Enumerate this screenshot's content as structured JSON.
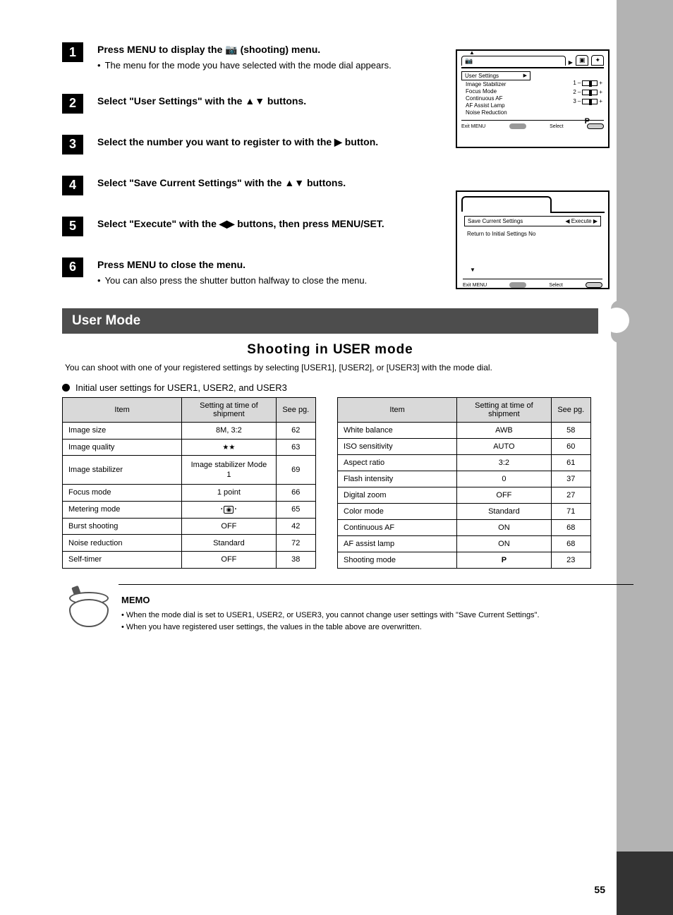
{
  "steps": [
    {
      "num": "1",
      "main_pre": "Press MENU to display the ",
      "main_icon": "📷",
      "main_post": " (shooting) menu.",
      "sub_a": "The menu for the mode you have selected with the mode dial appears."
    },
    {
      "num": "2",
      "main": "Select \"User Settings\" with the ▲▼ buttons."
    },
    {
      "num": "3",
      "main": "Select the number you want to register to with the ▶ button."
    },
    {
      "num": "4",
      "main": "Select \"Save Current Settings\" with the ▲▼ buttons."
    },
    {
      "num": "5",
      "main": "Select \"Execute\" with the ◀▶ buttons, then press MENU/SET."
    },
    {
      "num": "6",
      "main": "Press MENU to close the menu.",
      "sub_a": "You can also press the shutter button halfway to close the menu."
    }
  ],
  "section": {
    "bar": "User Mode",
    "sub_pre": "Shooting in ",
    "sub_key": "USER",
    "sub_post": " mode",
    "desc": "You can shoot with one of your registered settings by selecting [USER1], [USER2], or [USER3] with the mode dial."
  },
  "bullet_line": "Initial user settings for USER1, USER2, and USER3",
  "table_left": {
    "headers": [
      "Item",
      "Setting at time of shipment",
      "See pg."
    ],
    "rows": [
      {
        "item": "Image size",
        "setting": "8M, 3:2",
        "pg": "62"
      },
      {
        "item": "Image quality",
        "setting": "★★",
        "pg": "63"
      },
      {
        "item": "Image stabilizer",
        "setting": "Image stabilizer Mode 1",
        "tall": true,
        "pg": "69"
      },
      {
        "item": "Focus mode",
        "setting": "1 point",
        "pg": "66"
      },
      {
        "item": "Metering mode",
        "setting": "METER_ICON",
        "pg": "65"
      },
      {
        "item": "Burst shooting",
        "setting": "OFF",
        "pg": "42"
      },
      {
        "item": "Noise reduction",
        "setting": "Standard",
        "pg": "72"
      },
      {
        "item": "Self-timer",
        "setting": "OFF",
        "pg": "38"
      }
    ]
  },
  "table_right": {
    "headers": [
      "Item",
      "Setting at time of shipment",
      "See pg."
    ],
    "rows": [
      {
        "item": "White balance",
        "setting": "AWB",
        "pg": "58"
      },
      {
        "item": "ISO sensitivity",
        "setting": "AUTO",
        "pg": "60"
      },
      {
        "item": "Aspect ratio",
        "setting": "3:2",
        "pg": "61"
      },
      {
        "item": "Flash intensity",
        "setting": "0",
        "pg": "37"
      },
      {
        "item": "Digital zoom",
        "setting": "OFF",
        "pg": "27"
      },
      {
        "item": "Color mode",
        "setting": "Standard",
        "pg": "71"
      },
      {
        "item": "Continuous AF",
        "setting": "ON",
        "pg": "68"
      },
      {
        "item": "AF assist lamp",
        "setting": "ON",
        "pg": "68"
      },
      {
        "item": "Shooting mode",
        "setting": "P",
        "pg": "23"
      }
    ]
  },
  "memo": {
    "label": "MEMO",
    "lines": [
      "When the mode dial is set to USER1, USER2, or USER3, you cannot change user settings with \"Save Current Settings\".",
      "When you have registered user settings, the values in the table above are overwritten."
    ]
  },
  "screen1": {
    "menu_sel": "User Settings",
    "items": [
      "Image Stabilizer",
      "Focus Mode",
      "Continuous AF",
      "AF Assist Lamp",
      "Noise Reduction"
    ],
    "sliders": [
      "1",
      "2",
      "3"
    ],
    "p": "P",
    "bot_left": "Exit  MENU",
    "bot_right": "Select"
  },
  "screen2": {
    "title": "Save Current Settings",
    "value": "Execute",
    "line2": "Return to Initial Settings         No",
    "bot_left": "Exit  MENU",
    "bot_right": "Select"
  },
  "page_number": "55"
}
